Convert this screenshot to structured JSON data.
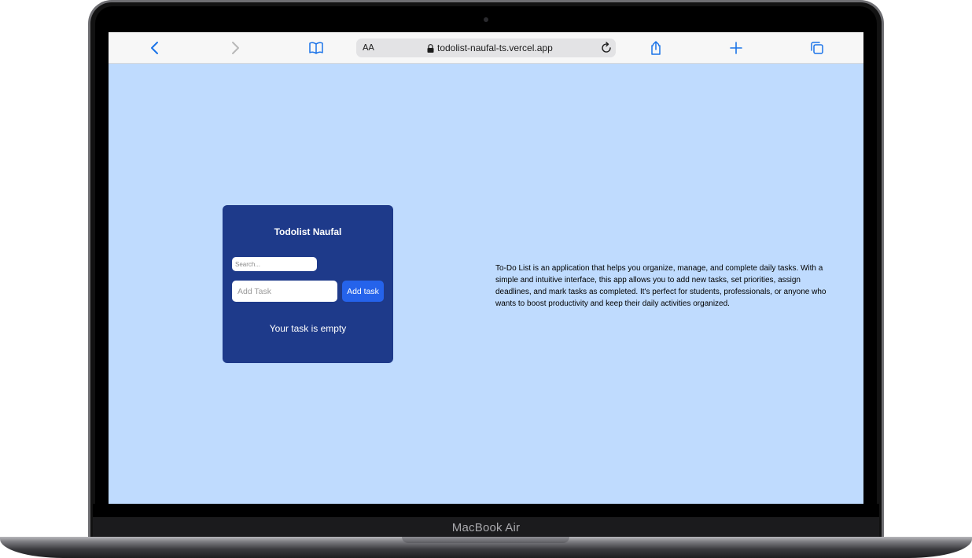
{
  "device": {
    "label": "MacBook Air"
  },
  "browser": {
    "text_size_label": "AA",
    "url": "todolist-naufal-ts.vercel.app",
    "icons": {
      "back": "chevron-left-icon",
      "forward": "chevron-right-icon",
      "bookmarks": "book-icon",
      "secure": "lock-icon",
      "reload": "reload-icon",
      "share": "share-icon",
      "new_tab": "plus-icon",
      "tabs": "tabs-icon"
    },
    "accent_color": "#1a73e8"
  },
  "app": {
    "title": "Todolist Naufal",
    "search_placeholder": "Search...",
    "add_placeholder": "Add Task",
    "add_button": "Add task",
    "empty_message": "Your task is empty",
    "colors": {
      "page_bg": "#bfdbfe",
      "card_bg": "#1e3a8a",
      "button_bg": "#2563eb"
    }
  },
  "description": "To-Do List is an application that helps you organize, manage, and complete daily tasks. With a simple and intuitive interface, this app allows you to add new tasks, set priorities, assign deadlines, and mark tasks as completed. It's perfect for students, professionals, or anyone who wants to boost productivity and keep their daily activities organized."
}
